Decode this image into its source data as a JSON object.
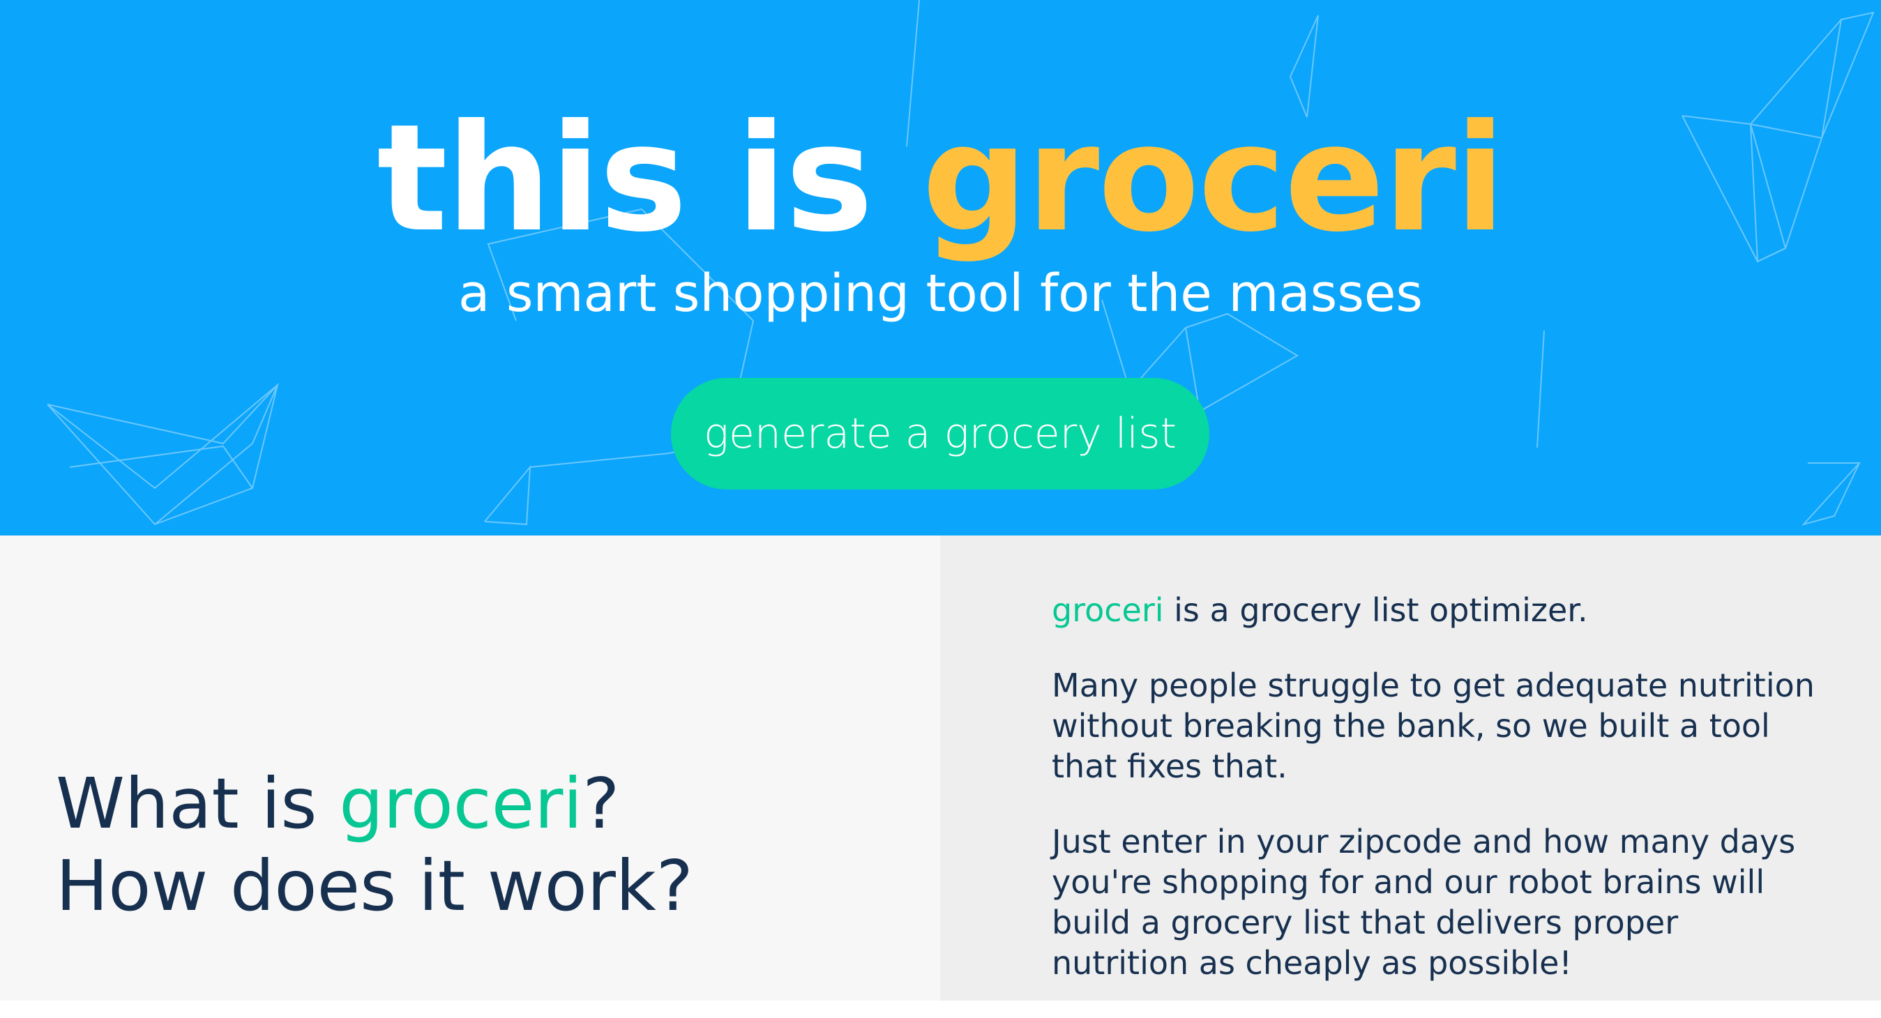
{
  "hero": {
    "title_prefix": "this is ",
    "title_brand": "groceri",
    "subtitle": "a smart shopping tool for the masses",
    "cta_label": "generate a grocery list",
    "colors": {
      "background": "#0ba5fb",
      "brand_yellow": "#ffc13d",
      "cta_green": "#07d7a2"
    }
  },
  "info": {
    "heading_line1_prefix": "What is ",
    "heading_brand": "groceri",
    "heading_line1_suffix": "?",
    "heading_line2": "How does it work?",
    "brand_inline": "groceri",
    "intro_rest": " is a grocery list optimizer.",
    "paragraph2": "Many people struggle to get adequate nutrition without breaking the bank, so we built a tool that fixes that.",
    "paragraph3": "Just enter in your zipcode and how many days you're shopping for and our robot brains will build a grocery list that delivers proper nutrition as cheaply as possible!",
    "colors": {
      "text": "#17304f",
      "accent": "#07c793"
    }
  }
}
